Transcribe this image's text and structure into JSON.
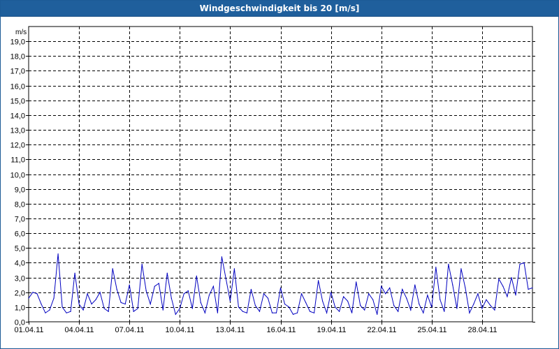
{
  "window": {
    "title": "Windgeschwindigkeit bis 20 [m/s]"
  },
  "colors": {
    "titlebar": "#1f5f9c",
    "line": "#0000c0",
    "grid": "#000000"
  },
  "chart_data": {
    "type": "line",
    "title": "Windgeschwindigkeit bis 20 [m/s]",
    "ylabel": "m/s",
    "xlabel": "",
    "ylim": [
      0,
      20
    ],
    "xlim": [
      "01.04.11",
      "01.05.11"
    ],
    "grid": true,
    "y_ticks": [
      "0,0",
      "1,0",
      "2,0",
      "3,0",
      "4,0",
      "5,0",
      "6,0",
      "7,0",
      "8,0",
      "9,0",
      "10,0",
      "11,0",
      "12,0",
      "13,0",
      "14,0",
      "15,0",
      "16,0",
      "17,0",
      "18,0",
      "19,0"
    ],
    "x_ticks": [
      "01.04.11",
      "04.04.11",
      "07.04.11",
      "10.04.11",
      "13.04.11",
      "16.04.11",
      "19.04.11",
      "22.04.11",
      "25.04.11",
      "28.04.11"
    ],
    "series": [
      {
        "name": "",
        "x": [
          "01.04.11 00:00",
          "01.04.11 06:00",
          "01.04.11 12:00",
          "01.04.11 18:00",
          "02.04.11 00:00",
          "02.04.11 06:00",
          "02.04.11 12:00",
          "02.04.11 18:00",
          "03.04.11 00:00",
          "03.04.11 06:00",
          "03.04.11 12:00",
          "03.04.11 18:00",
          "04.04.11 00:00",
          "04.04.11 06:00",
          "04.04.11 12:00",
          "04.04.11 18:00",
          "05.04.11 00:00",
          "05.04.11 06:00",
          "05.04.11 12:00",
          "05.04.11 18:00",
          "06.04.11 00:00",
          "06.04.11 06:00",
          "06.04.11 12:00",
          "06.04.11 18:00",
          "07.04.11 00:00",
          "07.04.11 06:00",
          "07.04.11 12:00",
          "07.04.11 18:00",
          "08.04.11 00:00",
          "08.04.11 06:00",
          "08.04.11 12:00",
          "08.04.11 18:00",
          "09.04.11 00:00",
          "09.04.11 06:00",
          "09.04.11 12:00",
          "09.04.11 18:00",
          "10.04.11 00:00",
          "10.04.11 06:00",
          "10.04.11 12:00",
          "10.04.11 18:00",
          "11.04.11 00:00",
          "11.04.11 06:00",
          "11.04.11 12:00",
          "11.04.11 18:00",
          "12.04.11 00:00",
          "12.04.11 06:00",
          "12.04.11 12:00",
          "12.04.11 18:00",
          "13.04.11 00:00",
          "13.04.11 06:00",
          "13.04.11 12:00",
          "13.04.11 18:00",
          "14.04.11 00:00",
          "14.04.11 06:00",
          "14.04.11 12:00",
          "14.04.11 18:00",
          "15.04.11 00:00",
          "15.04.11 06:00",
          "15.04.11 12:00",
          "15.04.11 18:00",
          "16.04.11 00:00",
          "16.04.11 06:00",
          "16.04.11 12:00",
          "16.04.11 18:00",
          "17.04.11 00:00",
          "17.04.11 06:00",
          "17.04.11 12:00",
          "17.04.11 18:00",
          "18.04.11 00:00",
          "18.04.11 06:00",
          "18.04.11 12:00",
          "18.04.11 18:00",
          "19.04.11 00:00",
          "19.04.11 06:00",
          "19.04.11 12:00",
          "19.04.11 18:00",
          "20.04.11 00:00",
          "20.04.11 06:00",
          "20.04.11 12:00",
          "20.04.11 18:00",
          "21.04.11 00:00",
          "21.04.11 06:00",
          "21.04.11 12:00",
          "21.04.11 18:00",
          "22.04.11 00:00",
          "22.04.11 06:00",
          "22.04.11 12:00",
          "22.04.11 18:00",
          "23.04.11 00:00",
          "23.04.11 06:00",
          "23.04.11 12:00",
          "23.04.11 18:00",
          "24.04.11 00:00",
          "24.04.11 06:00",
          "24.04.11 12:00",
          "24.04.11 18:00",
          "25.04.11 00:00",
          "25.04.11 06:00",
          "25.04.11 12:00",
          "25.04.11 18:00",
          "26.04.11 00:00",
          "26.04.11 06:00",
          "26.04.11 12:00",
          "26.04.11 18:00",
          "27.04.11 00:00",
          "27.04.11 06:00",
          "27.04.11 12:00",
          "27.04.11 18:00",
          "28.04.11 00:00",
          "28.04.11 06:00",
          "28.04.11 12:00",
          "28.04.11 18:00",
          "29.04.11 00:00",
          "29.04.11 06:00",
          "29.04.11 12:00",
          "29.04.11 18:00",
          "30.04.11 00:00",
          "30.04.11 06:00",
          "30.04.11 12:00",
          "30.04.11 18:00",
          "01.05.11 00:00"
        ],
        "values": [
          1.6,
          2.0,
          1.9,
          1.2,
          0.6,
          0.8,
          1.6,
          4.6,
          1.0,
          0.6,
          0.7,
          3.3,
          1.2,
          0.8,
          1.9,
          1.2,
          1.5,
          2.0,
          0.9,
          0.7,
          3.6,
          2.2,
          1.3,
          1.2,
          2.5,
          0.7,
          0.9,
          3.9,
          2.1,
          1.2,
          2.4,
          2.6,
          0.8,
          3.3,
          1.6,
          0.5,
          0.9,
          1.9,
          2.1,
          0.9,
          3.1,
          1.3,
          0.6,
          1.8,
          2.4,
          0.6,
          4.4,
          2.9,
          1.4,
          3.6,
          1.0,
          0.7,
          0.6,
          2.2,
          1.1,
          0.7,
          1.9,
          1.6,
          0.6,
          0.6,
          2.3,
          1.2,
          1.0,
          0.5,
          0.6,
          1.9,
          1.3,
          0.7,
          0.6,
          2.8,
          1.4,
          0.6,
          2.0,
          1.0,
          0.7,
          1.7,
          1.4,
          0.6,
          2.7,
          1.1,
          0.8,
          1.9,
          1.5,
          0.5,
          2.4,
          1.9,
          2.3,
          1.1,
          0.7,
          2.2,
          1.6,
          0.8,
          2.5,
          1.2,
          0.6,
          1.8,
          1.0,
          3.7,
          1.5,
          0.7,
          3.9,
          2.5,
          0.9,
          3.6,
          2.3,
          0.6,
          1.2,
          1.9,
          0.9,
          1.5,
          1.1,
          0.8,
          2.9,
          2.4,
          1.7,
          3.0,
          1.8,
          3.9,
          4.0,
          2.2,
          2.3
        ]
      }
    ]
  }
}
